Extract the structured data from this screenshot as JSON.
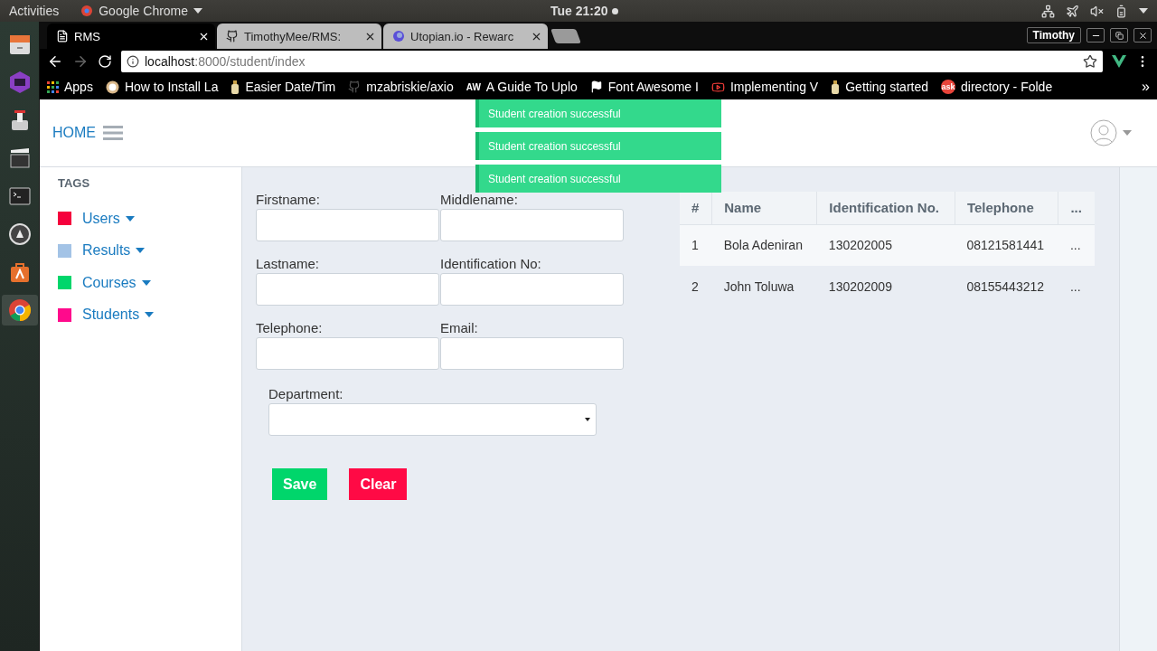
{
  "system_bar": {
    "activities": "Activities",
    "app": "Google Chrome",
    "clock": "Tue 21:20"
  },
  "browser": {
    "tabs": [
      {
        "title": "RMS",
        "selected": true,
        "kind": "page"
      },
      {
        "title": "TimothyMee/RMS:",
        "selected": false,
        "kind": "github"
      },
      {
        "title": "Utopian.io - Rewarc",
        "selected": false,
        "kind": "utopian"
      }
    ],
    "profile": "Timothy",
    "url_host": "localhost",
    "url_path": ":8000/student/index",
    "bookmarks": [
      {
        "label": "Apps",
        "kind": "apps"
      },
      {
        "label": "How to Install La",
        "kind": "round"
      },
      {
        "label": "Easier Date/Tim",
        "kind": "bottle"
      },
      {
        "label": "mzabriskie/axio",
        "kind": "github"
      },
      {
        "label": "A Guide To Uplo",
        "kind": "text",
        "badge": "AW"
      },
      {
        "label": "Font Awesome I",
        "kind": "flag"
      },
      {
        "label": "Implementing V",
        "kind": "video"
      },
      {
        "label": "Getting started",
        "kind": "bottle"
      },
      {
        "label": "directory - Folde",
        "kind": "ask",
        "badge": "ask"
      }
    ],
    "more": "»"
  },
  "app": {
    "home": "HOME",
    "tags_title": "TAGS",
    "tags": [
      {
        "label": "Users",
        "color": "#f5003d"
      },
      {
        "label": "Results",
        "color": "#a3c3e6"
      },
      {
        "label": "Courses",
        "color": "#00d66b"
      },
      {
        "label": "Students",
        "color": "#ff0a8c"
      }
    ],
    "fields": [
      {
        "label": "Firstname:"
      },
      {
        "label": "Middlename:"
      },
      {
        "label": "Lastname:"
      },
      {
        "label": "Identification No:"
      },
      {
        "label": "Telephone:"
      },
      {
        "label": "Email:"
      }
    ],
    "department": {
      "label": "Department:"
    },
    "buttons": [
      {
        "label": "Save",
        "kind": "save"
      },
      {
        "label": "Clear",
        "kind": "clear"
      }
    ],
    "toasts": [
      {
        "text": "Student creation successful"
      },
      {
        "text": "Student creation successful"
      },
      {
        "text": "Student creation successful"
      }
    ],
    "table": {
      "columns": [
        "#",
        "Name",
        "Identification No.",
        "Telephone",
        "..."
      ],
      "rows": [
        [
          "1",
          "Bola Adeniran",
          "130202005",
          "08121581441",
          "..."
        ],
        [
          "2",
          "John Toluwa",
          "130202009",
          "08155443212",
          "..."
        ]
      ]
    }
  }
}
